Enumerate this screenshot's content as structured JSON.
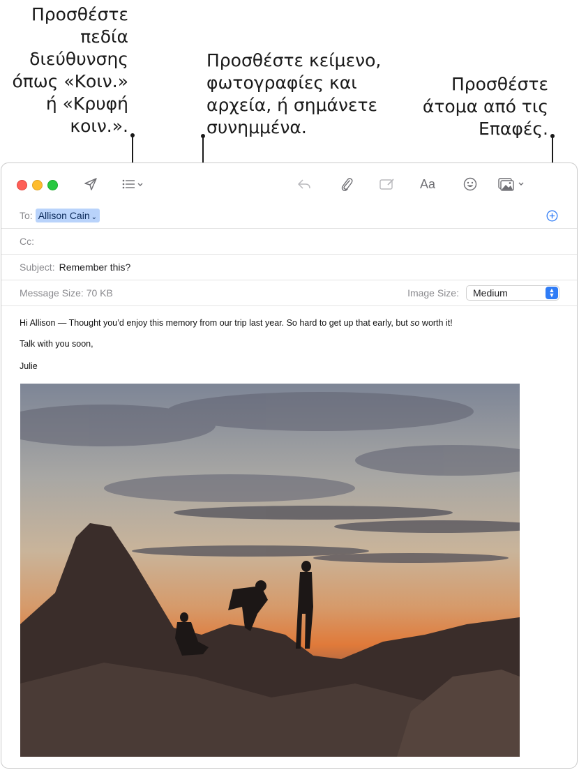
{
  "callouts": {
    "left": "Προσθέστε\nπεδία\nδιεύθυνσης\nόπως «Κοιν.»\nή «Κρυφή\nκοιν.».",
    "middle": "Προσθέστε κείμενο,\nφωτογραφίες και\nαρχεία, ή σημάνετε\nσυνημμένα.",
    "right": "Προσθέστε\nάτομα από τις\nΕπαφές."
  },
  "toolbar": {
    "icons": [
      "send-icon",
      "header-fields-icon",
      "reply-icon",
      "attach-icon",
      "markup-icon",
      "format-icon",
      "emoji-icon",
      "photo-browser-icon"
    ],
    "format_label": "Aa"
  },
  "header": {
    "to_label": "To:",
    "to_recipient": "Allison Cain",
    "cc_label": "Cc:",
    "subject_label": "Subject:",
    "subject_value": "Remember this?",
    "message_size": "Message Size: 70 KB",
    "image_size_label": "Image Size:",
    "image_size_value": "Medium"
  },
  "body": {
    "line1_a": "Hi Allison — Thought you’d enjoy this memory from our trip last year. So hard to get up that early, but ",
    "line1_em": "so",
    "line1_b": " worth it!",
    "line2": "Talk with you soon,",
    "line3": "Julie"
  },
  "colors": {
    "accent": "#2f7cf6",
    "token_bg": "#b9d3fb",
    "close": "#fe5f57",
    "minimize": "#febc2e",
    "maximize": "#28c840"
  }
}
